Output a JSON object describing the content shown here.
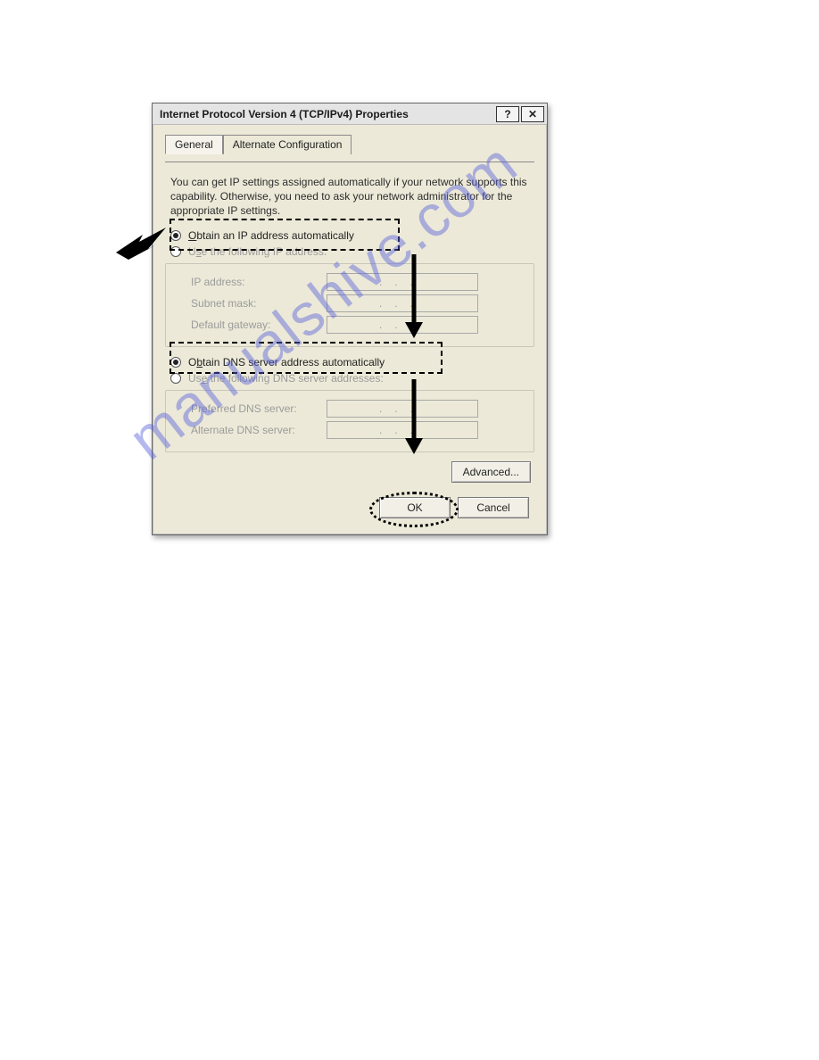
{
  "titlebar": {
    "title": "Internet Protocol Version 4 (TCP/IPv4) Properties",
    "help_label": "?",
    "close_label": "✕"
  },
  "tabs": {
    "general": "General",
    "alternate": "Alternate Configuration"
  },
  "intro": "You can get IP settings assigned automatically if your network supports this capability. Otherwise, you need to ask your network administrator for the appropriate IP settings.",
  "ip_section": {
    "auto_prefix_underlined": "O",
    "auto_rest": "btain an IP address automatically",
    "manual_prefix": "U",
    "manual_underlined": "s",
    "manual_rest": "e the following IP address:",
    "fields": {
      "ip_prefix_underlined": "I",
      "ip_rest": "P address:",
      "subnet_prefix": "S",
      "subnet_underlined": "u",
      "subnet_rest": "bnet mask:",
      "gateway_prefix_underlined": "D",
      "gateway_rest": "efault gateway:"
    }
  },
  "dns_section": {
    "auto_prefix": "O",
    "auto_underlined": "b",
    "auto_rest": "tain DNS server address automatically",
    "manual_prefix": "Us",
    "manual_underlined": "e",
    "manual_rest": " the following DNS server addresses:",
    "fields": {
      "preferred_prefix_underlined": "P",
      "preferred_rest": "referred DNS server:",
      "alternate_prefix_underlined": "A",
      "alternate_rest": "lternate DNS server:"
    }
  },
  "buttons": {
    "advanced_prefix": "Ad",
    "advanced_underlined": "v",
    "advanced_rest": "anced...",
    "ok": "OK",
    "cancel": "Cancel"
  },
  "ip_placeholder": "...",
  "watermark": "manualshive.com"
}
